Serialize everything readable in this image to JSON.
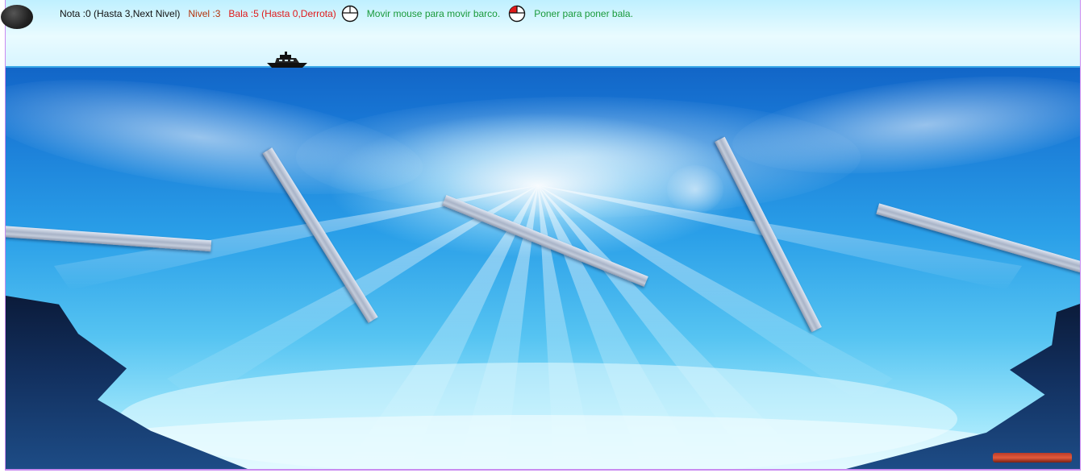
{
  "hud": {
    "score_text": "Nota :0 (Hasta 3,Next Nivel)",
    "level_text": "Nivel :3",
    "bullet_text": "Bala :5 (Hasta 0,Derrota)",
    "move_hint": "Movir mouse para movir barco.",
    "fire_hint": "Poner para poner bala."
  },
  "icons": {
    "move": "mouse-icon",
    "fire": "mouse-left-click-icon",
    "boat": "boat-icon",
    "cannon": "cannon-icon",
    "ball": "cannonball-icon"
  },
  "colors": {
    "score": "#111111",
    "level": "#b3320a",
    "bullet": "#e01a1a",
    "hint": "#1a9a3a",
    "frame": "#c98bf0"
  }
}
